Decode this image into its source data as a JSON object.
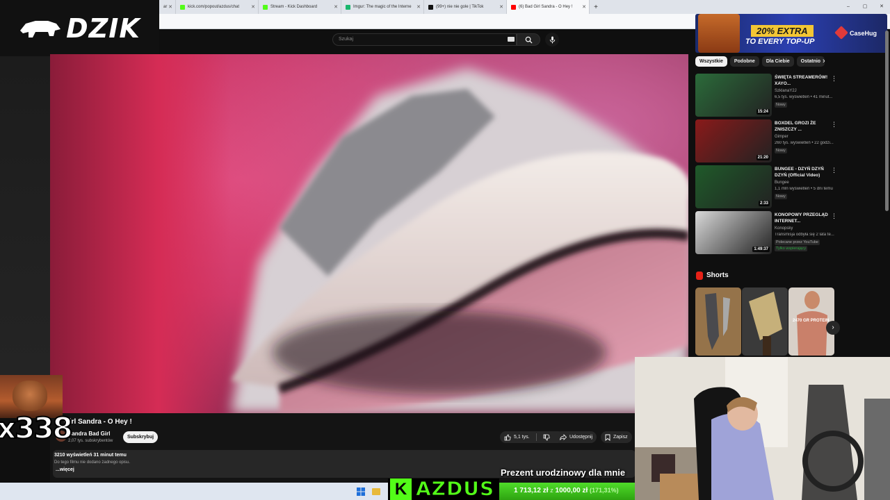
{
  "browser": {
    "tabs": [
      {
        "label": "ar",
        "favicon_color": "#888888",
        "active": false
      },
      {
        "label": "kick.com/popout/azdus/chat",
        "favicon_color": "#53fc18",
        "active": false
      },
      {
        "label": "Stream - Kick Dashboard",
        "favicon_color": "#53fc18",
        "active": false
      },
      {
        "label": "Imgur: The magic of the Interne",
        "favicon_color": "#1bb76e",
        "active": false
      },
      {
        "label": "(99+) nie nie gole | TikTok",
        "favicon_color": "#111111",
        "active": false
      },
      {
        "label": "(6) Bad Girl Sandra - O Hey !",
        "favicon_color": "#ff0000",
        "active": true
      }
    ],
    "new_tab": "+",
    "window_controls": [
      "–",
      "▢",
      "✕"
    ]
  },
  "overlay": {
    "logo_text": "DZIK",
    "combo_text": "x338",
    "gift_message": "Prezent urodzinowy dla mnie",
    "brand_letter": "K",
    "brand_name": "AZDUS"
  },
  "youtube": {
    "search": {
      "placeholder": "Szukaj"
    },
    "video": {
      "title": "Girl Sandra - O Hey !",
      "channel": "Sandra Bad Girl",
      "subscribers": "2,07 tys. subskrybentów",
      "subscribe_label": "Subskrybuj",
      "likes": "5,1 tys.",
      "share_label": "Udostępnij",
      "save_label": "Zapisz",
      "views_time": "3210 wyświetleń  31 minut temu",
      "no_description": "Do tego filmu nie dodano żadnego opisu.",
      "more_label": "...więcej"
    },
    "chips": [
      {
        "label": "Wszystkie",
        "active": true
      },
      {
        "label": "Podobne",
        "active": false
      },
      {
        "label": "Dla Ciebie",
        "active": false
      },
      {
        "label": "Ostatnio",
        "active": false
      }
    ],
    "recommendations": [
      {
        "title": "ŚWIĘTA STREAMERÓW! XAYO...",
        "channel": "SzklanaY2J",
        "meta": "6,5 tys. wyświetleń • 41 minut...",
        "badge": "Nowy",
        "duration": "15:24",
        "thumb_color": "#2b6b3a"
      },
      {
        "title": "BOXDEL GROZI ŻE ZNISZCZY ...",
        "channel": "Gimper",
        "meta": "260 tys. wyświetleń • 22 godzi...",
        "badge": "Nowy",
        "duration": "21:20",
        "thumb_color": "#8a1a1a"
      },
      {
        "title": "BUNGEE - DZYŃ DZYŃ DZYŃ (Official Video)",
        "channel": "Bungee",
        "meta": "1,1 mln wyświetleń • 5 dni temu",
        "badge": "Nowy",
        "duration": "2:33",
        "thumb_color": "#1f5a2a"
      },
      {
        "title": "KONOPOWY PRZEGLĄD INTERNET...",
        "channel": "Konopsky",
        "meta": "Transmisja odbyła się 2 lata te...",
        "badge": "Polecane przez YouTube",
        "extra": "Tylko wspierający",
        "duration": "1:49:37",
        "thumb_color": "#d9d9d9"
      }
    ],
    "shorts": {
      "title": "Shorts",
      "items": [
        {
          "label": "",
          "thumb_color": "#6b4a2a"
        },
        {
          "label": "",
          "thumb_color": "#8a7a3a"
        },
        {
          "label": "2470 GR PROTEIN",
          "thumb_color": "#a85a4a"
        }
      ]
    }
  },
  "ad": {
    "line1": "20% EXTRA",
    "line2": "TO EVERY TOP-UP",
    "brand": "CaseHug"
  },
  "donation_goal": {
    "current": "1 713,12 zł",
    "separator": "z",
    "target": "1000,00 zł",
    "percent_text": "(171,31%)",
    "progress_fraction": 1.0
  }
}
